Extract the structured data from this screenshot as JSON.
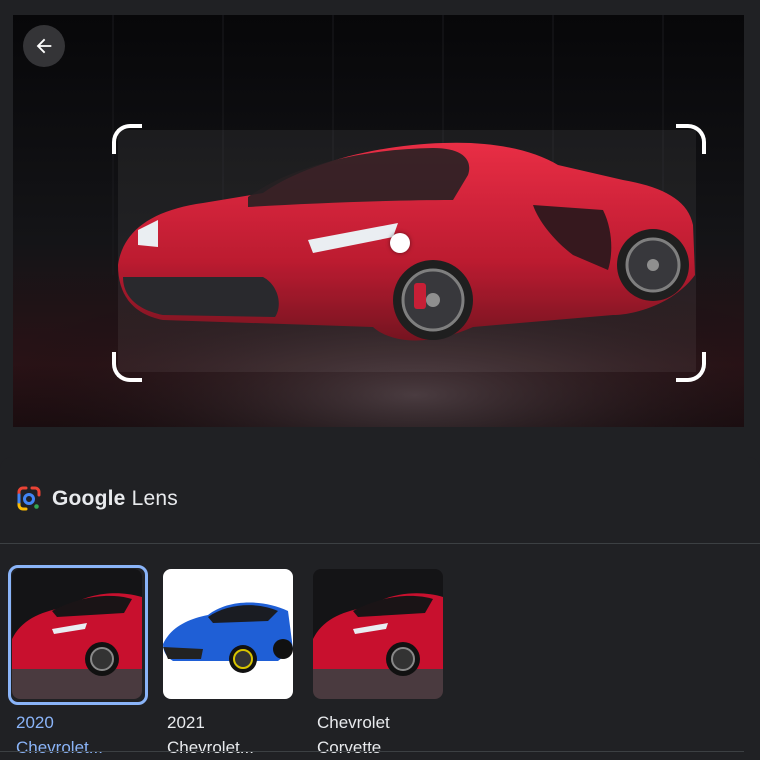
{
  "viewer": {
    "back_icon": "arrow-left-icon",
    "image_subject": "red-sports-car"
  },
  "lens": {
    "logo_icon": "google-lens-icon",
    "brand_word": "Google",
    "product_word": "Lens"
  },
  "results": [
    {
      "line1": "2020",
      "line2": "Chevrolet...",
      "thumb_color": "#c8102e",
      "selected": true
    },
    {
      "line1": "2021",
      "line2": "Chevrolet...",
      "thumb_color": "#1f5fd6",
      "selected": false
    },
    {
      "line1": "Chevrolet",
      "line2": "Corvette",
      "thumb_color": "#c8102e",
      "selected": false
    }
  ],
  "colors": {
    "accent": "#8ab4f8",
    "background": "#202124",
    "text": "#e8eaed"
  }
}
